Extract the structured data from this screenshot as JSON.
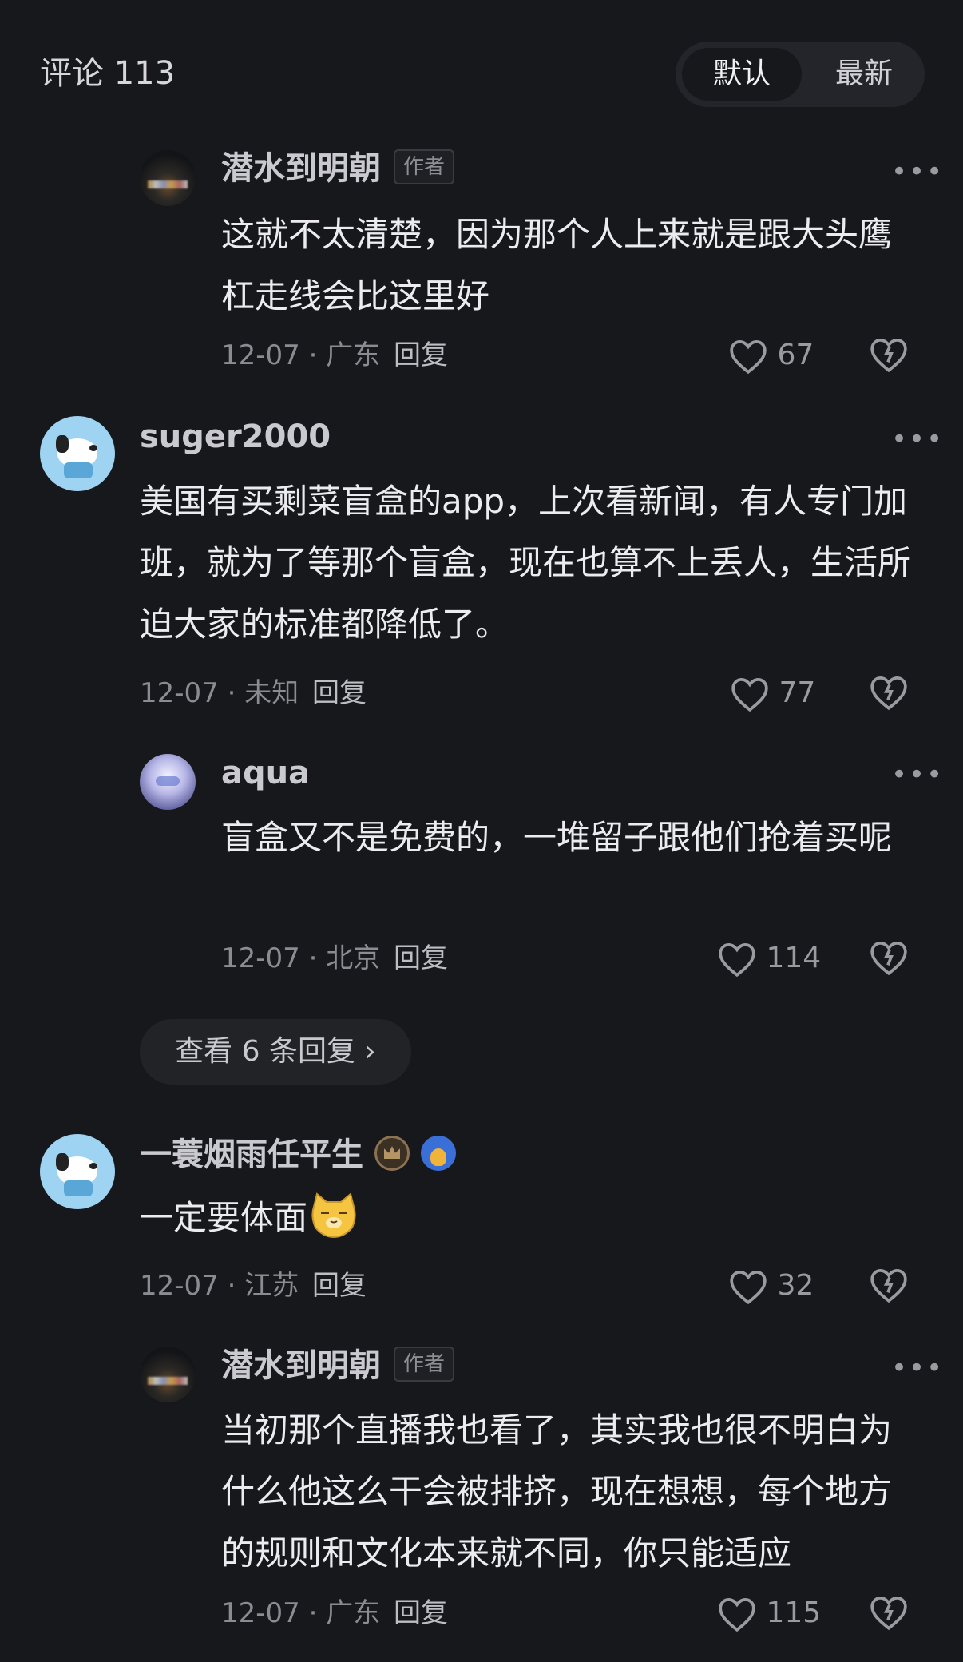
{
  "header": {
    "title": "评论 113",
    "sort_options": [
      "默认",
      "最新"
    ]
  },
  "comments": [
    {
      "user": "潜水到明朝",
      "tag": "作者",
      "text": "这就不太清楚，因为那个人上来就是跟大头鹰杠走线会比这里好",
      "date_loc": "12-07 · 广东",
      "reply_label": "回复",
      "likes": "67"
    },
    {
      "user": "suger2000",
      "text": "美国有买剩菜盲盒的app，上次看新闻，有人专门加班，就为了等那个盲盒，现在也算不上丢人，生活所迫大家的标准都降低了。",
      "date_loc": "12-07 · 未知",
      "reply_label": "回复",
      "likes": "77"
    },
    {
      "user": "aqua",
      "text": "盲盒又不是免费的，一堆留子跟他们抢着买呢",
      "date_loc": "12-07 · 北京",
      "reply_label": "回复",
      "likes": "114"
    },
    {
      "user": "一蓑烟雨任平生",
      "text": "一定要体面",
      "date_loc": "12-07 · 江苏",
      "reply_label": "回复",
      "likes": "32"
    },
    {
      "user": "潜水到明朝",
      "tag": "作者",
      "text": "当初那个直播我也看了，其实我也很不明白为什么他这么干会被排挤，现在想想，每个地方的规则和文化本来就不同，你只能适应",
      "date_loc": "12-07 · 广东",
      "reply_label": "回复",
      "likes": "115"
    }
  ],
  "expand_replies": "查看 6 条回复 ›",
  "icons": {
    "more": "more-dots-icon",
    "like": "heart-icon",
    "dislike": "broken-heart-icon"
  },
  "colors": {
    "background": "#17181b",
    "text_primary": "#ececf0",
    "text_secondary": "#8b8b92"
  }
}
